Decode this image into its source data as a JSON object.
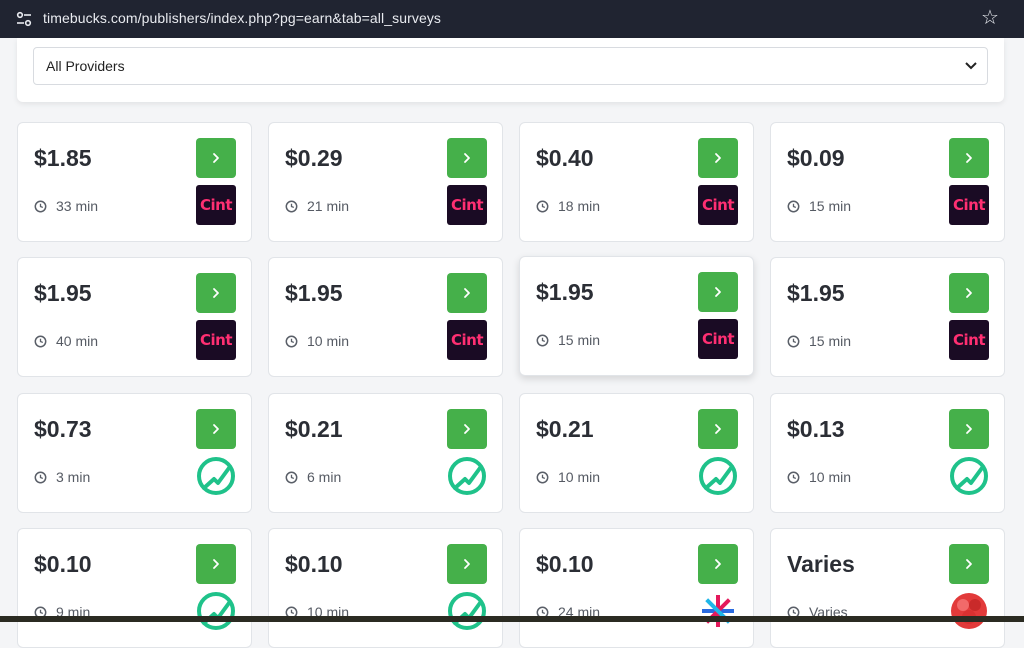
{
  "browser": {
    "url": "timebucks.com/publishers/index.php?pg=earn&tab=all_surveys"
  },
  "filter": {
    "selected": "All Providers"
  },
  "surveys": [
    {
      "price": "$1.85",
      "duration": "33 min",
      "provider": "cint",
      "logo_text": "Cint"
    },
    {
      "price": "$0.29",
      "duration": "21 min",
      "provider": "cint",
      "logo_text": "Cint"
    },
    {
      "price": "$0.40",
      "duration": "18 min",
      "provider": "cint",
      "logo_text": "Cint"
    },
    {
      "price": "$0.09",
      "duration": "15 min",
      "provider": "cint",
      "logo_text": "Cint"
    },
    {
      "price": "$1.95",
      "duration": "40 min",
      "provider": "cint",
      "logo_text": "Cint"
    },
    {
      "price": "$1.95",
      "duration": "10 min",
      "provider": "cint",
      "logo_text": "Cint"
    },
    {
      "price": "$1.95",
      "duration": "15 min",
      "provider": "cint",
      "logo_text": "Cint"
    },
    {
      "price": "$1.95",
      "duration": "15 min",
      "provider": "cint",
      "logo_text": "Cint"
    },
    {
      "price": "$0.73",
      "duration": "3 min",
      "provider": "green-check-logo"
    },
    {
      "price": "$0.21",
      "duration": "6 min",
      "provider": "green-check-logo"
    },
    {
      "price": "$0.21",
      "duration": "10 min",
      "provider": "green-check-logo"
    },
    {
      "price": "$0.13",
      "duration": "10 min",
      "provider": "green-check-logo"
    },
    {
      "price": "$0.10",
      "duration": "9 min",
      "provider": "green-check-logo"
    },
    {
      "price": "$0.10",
      "duration": "10 min",
      "provider": "green-check-logo"
    },
    {
      "price": "$0.10",
      "duration": "24 min",
      "provider": "colorful-star-logo"
    },
    {
      "price": "Varies",
      "duration": "Varies",
      "provider": "red-circle-logo"
    }
  ],
  "colors": {
    "go_button": "#45b04a",
    "cint_bg": "#1a0b24",
    "cint_text": "#ff2f72",
    "green_logo": "#1fc28a"
  }
}
